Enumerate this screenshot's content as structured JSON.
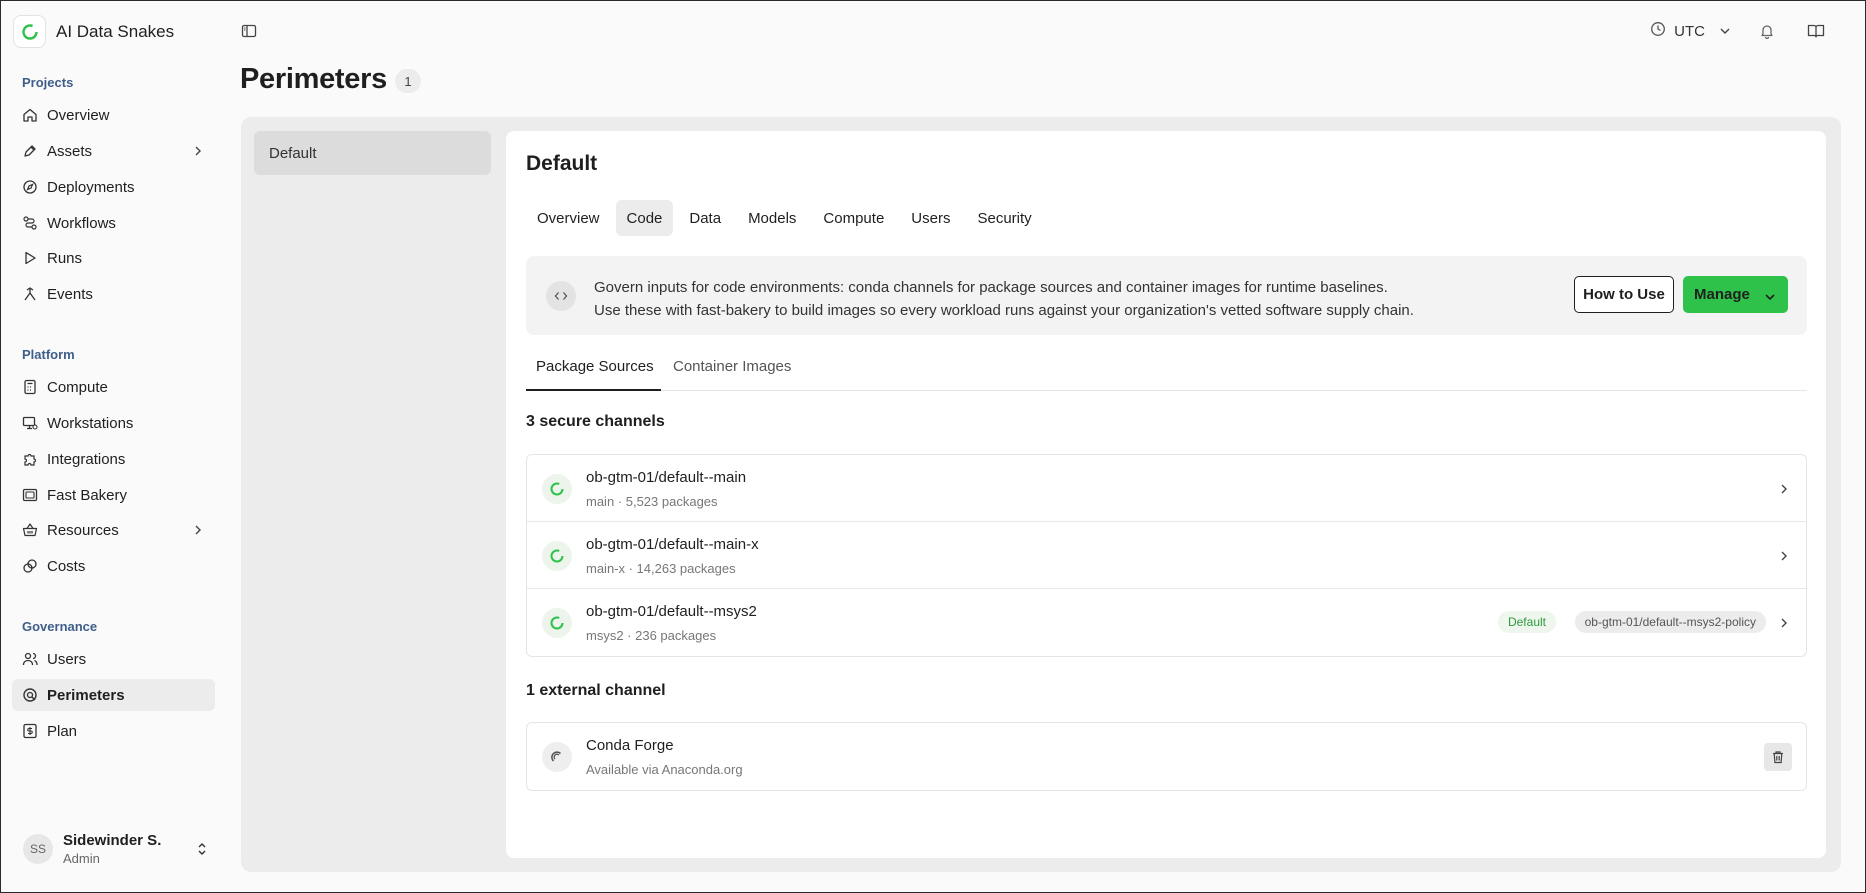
{
  "brand": {
    "name": "AI Data Snakes",
    "logo_icon": "ring-logo-icon"
  },
  "topbar": {
    "timezone": "UTC"
  },
  "sidebar": {
    "sections": {
      "projects": "Projects",
      "platform": "Platform",
      "governance": "Governance"
    },
    "items": [
      {
        "label": "Overview",
        "icon": "home-icon"
      },
      {
        "label": "Assets",
        "icon": "pen-icon"
      },
      {
        "label": "Deployments",
        "icon": "compass-icon"
      },
      {
        "label": "Workflows",
        "icon": "workflow-icon"
      },
      {
        "label": "Runs",
        "icon": "play-icon"
      },
      {
        "label": "Events",
        "icon": "events-icon"
      },
      {
        "label": "Compute",
        "icon": "calculator-icon"
      },
      {
        "label": "Workstations",
        "icon": "workstation-icon"
      },
      {
        "label": "Integrations",
        "icon": "puzzle-icon"
      },
      {
        "label": "Fast Bakery",
        "icon": "bakery-icon"
      },
      {
        "label": "Resources",
        "icon": "basket-icon"
      },
      {
        "label": "Costs",
        "icon": "coins-icon"
      },
      {
        "label": "Users",
        "icon": "users-icon"
      },
      {
        "label": "Perimeters",
        "icon": "perimeter-icon"
      },
      {
        "label": "Plan",
        "icon": "dollar-icon"
      }
    ],
    "user": {
      "initials": "SS",
      "name": "Sidewinder S.",
      "role": "Admin"
    }
  },
  "page": {
    "title": "Perimeters",
    "count": "1",
    "perimeter_list": [
      "Default"
    ]
  },
  "detail": {
    "title": "Default",
    "tabs": [
      "Overview",
      "Code",
      "Data",
      "Models",
      "Compute",
      "Users",
      "Security"
    ],
    "active_tab": "Code",
    "banner": {
      "line1": "Govern inputs for code environments: conda channels for package sources and container images for runtime baselines.",
      "line2": "Use these with fast-bakery to build images so every workload runs against your organization's vetted software supply chain.",
      "how_button": "How to Use",
      "manage_button": "Manage"
    },
    "subtabs": [
      "Package Sources",
      "Container Images"
    ],
    "secure_heading": "3 secure channels",
    "secure_channels": [
      {
        "name": "ob-gtm-01/default--main",
        "meta": "main · 5,523 packages"
      },
      {
        "name": "ob-gtm-01/default--main-x",
        "meta": "main-x · 14,263 packages"
      },
      {
        "name": "ob-gtm-01/default--msys2",
        "meta": "msys2 · 236 packages",
        "tag_default": "Default",
        "tag_policy": "ob-gtm-01/default--msys2-policy"
      }
    ],
    "external_heading": "1 external channel",
    "external_channels": [
      {
        "name": "Conda Forge",
        "meta": "Available via Anaconda.org"
      }
    ]
  },
  "colors": {
    "accent": "#2ec24a",
    "section_label": "#3f5e8a"
  }
}
